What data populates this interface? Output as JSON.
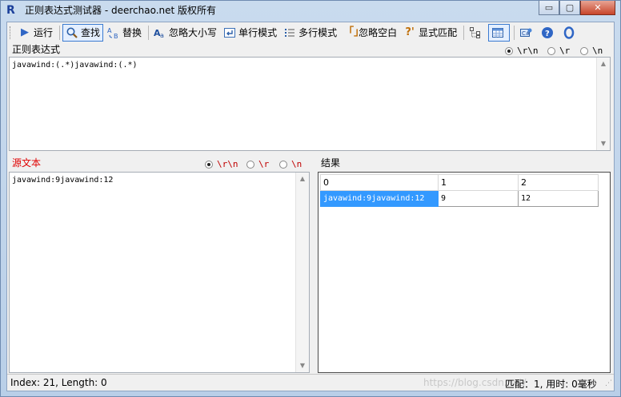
{
  "window": {
    "title": "正则表达式测试器 - deerchao.net 版权所有",
    "icon_letter": "R",
    "minimize": "▭",
    "maximize": "▢",
    "close": "✕"
  },
  "toolbar": {
    "run": "运行",
    "find": "查找",
    "replace": "替换",
    "ignore_case": "忽略大小写",
    "single_line": "单行模式",
    "multi_line": "多行模式",
    "ignore_whitespace": "忽略空白",
    "explicit_capture": "显式匹配"
  },
  "regex_section": {
    "label": "正则表达式",
    "newline_options": [
      "\\r\\n",
      "\\r",
      "\\n"
    ],
    "selected_newline": "\\r\\n",
    "value": "javawind:(.*)javawind:(.*)"
  },
  "source_section": {
    "label": "源文本",
    "newline_options": [
      "\\r\\n",
      "\\r",
      "\\n"
    ],
    "selected_newline": "\\r\\n",
    "value": "javawind:9javawind:12"
  },
  "results_section": {
    "label": "结果",
    "headers": [
      "0",
      "1",
      "2"
    ],
    "rows": [
      [
        "javawind:9javawind:12",
        "9",
        "12"
      ]
    ]
  },
  "status": {
    "left": "Index: 21, Length: 0",
    "right": "匹配：1, 用时: 0毫秒",
    "watermark": "https://blog.csdn.net/"
  },
  "colors": {
    "selected_cell": "#3399ff",
    "source_label": "#e00000"
  }
}
